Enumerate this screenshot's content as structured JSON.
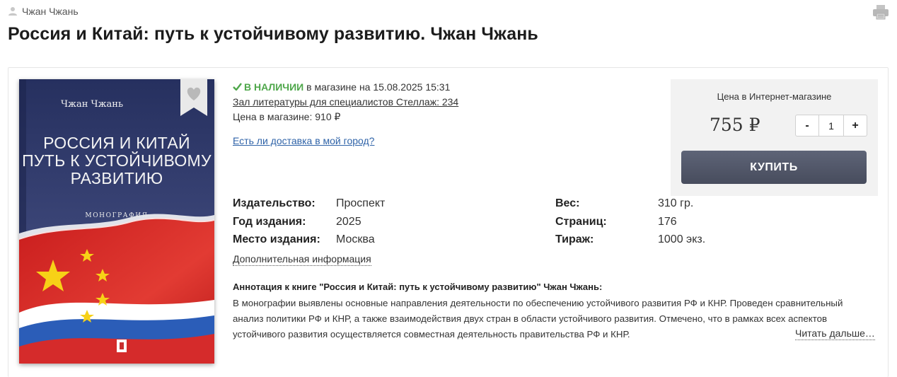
{
  "header": {
    "author": "Чжан Чжань",
    "title": "Россия и Китай: путь к устойчивому развитию. Чжан Чжань"
  },
  "icons": {
    "user": "user-icon",
    "print": "printer-icon",
    "check": "check-icon",
    "favorite": "heart-icon"
  },
  "colors": {
    "in_stock": "#4fa74b",
    "link": "#2f63a8",
    "buy_button": "#4f5467",
    "cover_bg": "#2f3a6e",
    "flag_red": "#d62a2a",
    "star_yellow": "#f7d117"
  },
  "cover": {
    "author": "Чжан Чжань",
    "title_lines": [
      "РОССИЯ И КИТАЙ",
      "ПУТЬ К УСТОЙЧИВОМУ",
      "РАЗВИТИЮ"
    ],
    "subtitle": "МОНОГРАФИЯ"
  },
  "availability": {
    "status": "В НАЛИЧИИ",
    "status_rest": " в магазине на 15.08.2025 15:31",
    "shelf": "Зал литературы для специалистов Стеллаж: 234",
    "store_price": "Цена в магазине: 910 ₽",
    "delivery_link": "Есть ли доставка в мой город?"
  },
  "buy": {
    "label": "Цена в Интернет-магазине",
    "price": "755 ₽",
    "quantity": "1",
    "minus": "-",
    "plus": "+",
    "button": "КУПИТЬ"
  },
  "specs": {
    "publisher_label": "Издательство:",
    "publisher": "Проспект",
    "year_label": "Год издания:",
    "year": "2025",
    "place_label": "Место издания:",
    "place": "Москва",
    "weight_label": "Вес:",
    "weight": "310 гр.",
    "pages_label": "Страниц:",
    "pages": "176",
    "print_run_label": "Тираж:",
    "print_run": "1000 экз.",
    "more": "Дополнительная информация"
  },
  "annotation": {
    "title": "Аннотация к книге \"Россия и Китай: путь к устойчивому развитию\" Чжан Чжань:",
    "text": "В монографии выявлены основные направления деятельности по обеспечению устойчивого развития РФ и КНР. Проведен сравнительный анализ политики РФ и КНР, а также взаимодействия двух стран в области устойчивого развития. Отмечено, что в рамках всех аспектов устойчивого развития осуществляется совместная деятельность правительства РФ и КНР.",
    "read_more": "Читать дальше…"
  }
}
